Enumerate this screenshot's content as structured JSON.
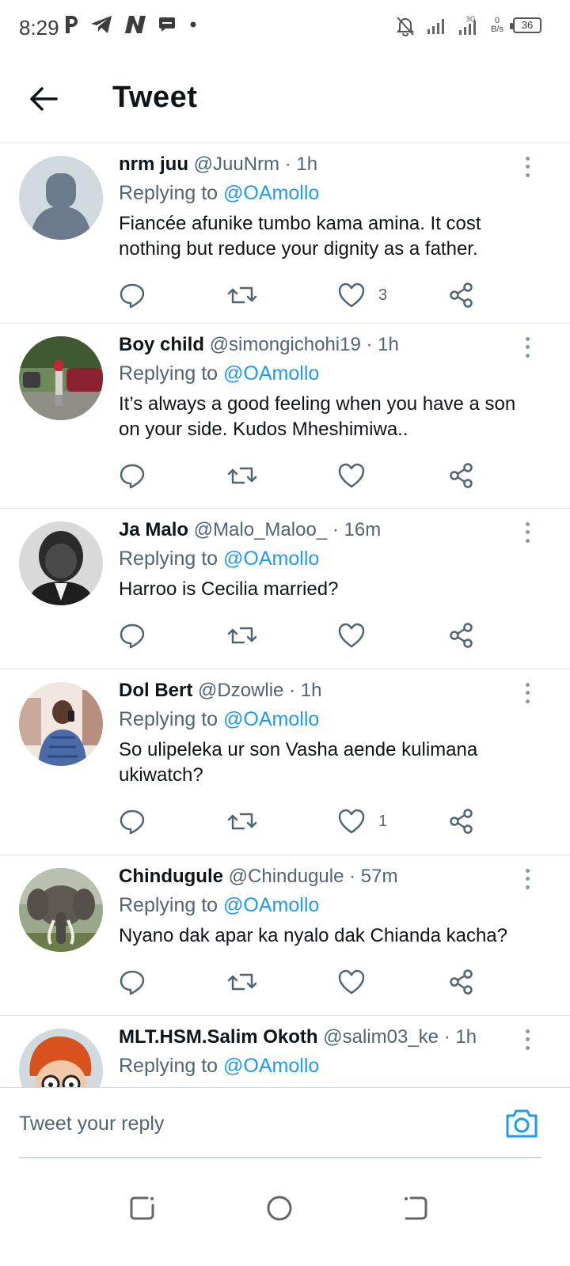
{
  "status_bar": {
    "time": "8:29",
    "left_icons": [
      "parking-icon",
      "telegram-icon",
      "n-app-icon",
      "message-icon",
      "dot-icon"
    ],
    "network_speed_value": "0",
    "network_speed_unit": "B/s",
    "battery": "36"
  },
  "header": {
    "title": "Tweet"
  },
  "tweets": [
    {
      "name": "nrm juu",
      "handle": "@JuuNrm",
      "time": "1h",
      "replying_prefix": "Replying to",
      "replying_to": "@OAmollo",
      "text": "Fiancée afunike tumbo kama amina. It cost nothing but reduce your dignity as a father.",
      "likes": "3",
      "avatar": "default-profile"
    },
    {
      "name": "Boy child",
      "handle": "@simongichohi19",
      "time": "1h",
      "replying_prefix": "Replying to",
      "replying_to": "@OAmollo",
      "text": "It’s always a good feeling when you have a son on your side. Kudos Mheshimiwa..",
      "likes": "",
      "avatar": "photo-car"
    },
    {
      "name": "Ja Malo",
      "handle": "@Malo_Maloo_",
      "time": "16m",
      "replying_prefix": "Replying to",
      "replying_to": "@OAmollo",
      "text": "Harroo is Cecilia married?",
      "likes": "",
      "avatar": "photo-portrait-bw"
    },
    {
      "name": "Dol Bert",
      "handle": "@Dzowlie",
      "time": "1h",
      "replying_prefix": "Replying to",
      "replying_to": "@OAmollo",
      "text": "So ulipeleka ur son Vasha aende kulimana ukiwatch?",
      "likes": "1",
      "avatar": "photo-man-phone"
    },
    {
      "name": "Chindugule",
      "handle": "@Chindugule",
      "time": "57m",
      "replying_prefix": "Replying to",
      "replying_to": "@OAmollo",
      "text": "Nyano dak apar ka nyalo dak Chianda kacha?",
      "likes": "",
      "avatar": "photo-elephant"
    },
    {
      "name": "MLT.HSM.Salim Okoth",
      "handle": "@salim03_ke",
      "time": "1h",
      "replying_prefix": "Replying to",
      "replying_to": "@OAmollo",
      "text": "",
      "likes": "",
      "avatar": "cartoon-redhead"
    }
  ],
  "reply_bar": {
    "placeholder": "Tweet your reply"
  },
  "colors": {
    "accent": "#1d9bf0",
    "text_primary": "#0f1419",
    "text_secondary": "#536471",
    "divider": "#e0e4e8"
  }
}
